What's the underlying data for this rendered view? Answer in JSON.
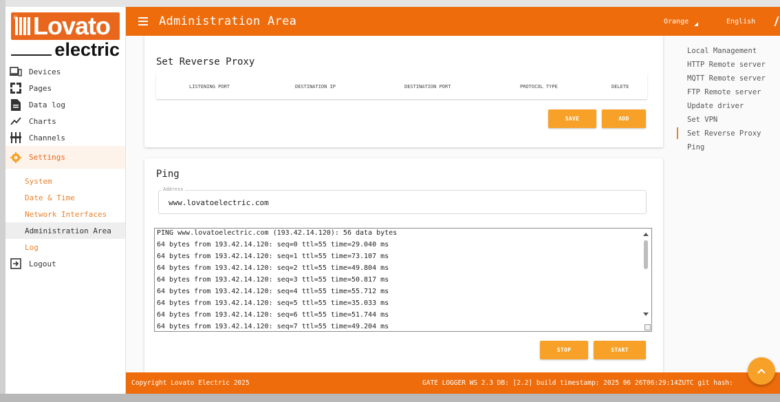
{
  "brand": {
    "logo_text": "Lovato",
    "logo_sub": "electric"
  },
  "colors": {
    "accent": "#ee6c0b",
    "button": "#f7a128",
    "link": "#e8822c"
  },
  "sidebar": {
    "items": [
      {
        "label": "Devices",
        "icon": "devices-icon"
      },
      {
        "label": "Pages",
        "icon": "pages-icon"
      },
      {
        "label": "Data log",
        "icon": "document-icon"
      },
      {
        "label": "Charts",
        "icon": "chart-line-icon"
      },
      {
        "label": "Channels",
        "icon": "channels-icon"
      },
      {
        "label": "Settings",
        "icon": "gear-icon"
      }
    ],
    "settings_sub": [
      "System",
      "Date & Time",
      "Network Interfaces",
      "Administration Area",
      "Log"
    ],
    "logout": "Logout"
  },
  "header": {
    "title": "Administration Area",
    "theme": "Orange",
    "language": "English"
  },
  "proxy": {
    "title": "Set Reverse Proxy",
    "columns": [
      "LISTENING PORT",
      "DESTINATION IP",
      "DESTINATION PORT",
      "PROTOCOL TYPE",
      "DELETE"
    ],
    "save_label": "SAVE",
    "add_label": "ADD"
  },
  "ping": {
    "title": "Ping",
    "address_label": "Address",
    "address_value": "www.lovatoelectric.com",
    "output": [
      "PING www.lovatoelectric.com (193.42.14.120): 56 data bytes",
      "64 bytes from 193.42.14.120: seq=0 ttl=55 time=29.040 ms",
      "64 bytes from 193.42.14.120: seq=1 ttl=55 time=73.107 ms",
      "64 bytes from 193.42.14.120: seq=2 ttl=55 time=49.804 ms",
      "64 bytes from 193.42.14.120: seq=3 ttl=55 time=50.817 ms",
      "64 bytes from 193.42.14.120: seq=4 ttl=55 time=55.712 ms",
      "64 bytes from 193.42.14.120: seq=5 ttl=55 time=35.033 ms",
      "64 bytes from 193.42.14.120: seq=6 ttl=55 time=51.744 ms",
      "64 bytes from 193.42.14.120: seq=7 ttl=55 time=49.204 ms"
    ],
    "stop_label": "STOP",
    "start_label": "START"
  },
  "right_nav": {
    "items": [
      "Local Management",
      "HTTP Remote server",
      "MQTT Remote server",
      "FTP Remote server",
      "Update driver",
      "Set VPN",
      "Set Reverse Proxy",
      "Ping"
    ],
    "active": "Set Reverse Proxy"
  },
  "footer": {
    "copyright": "Copyright Lovato Electric   2025",
    "build": "GATE LOGGER WS 2.3 DB: [2.2]   build timestamp: 2025 06 26T06:29:14ZUTC   git hash:"
  }
}
